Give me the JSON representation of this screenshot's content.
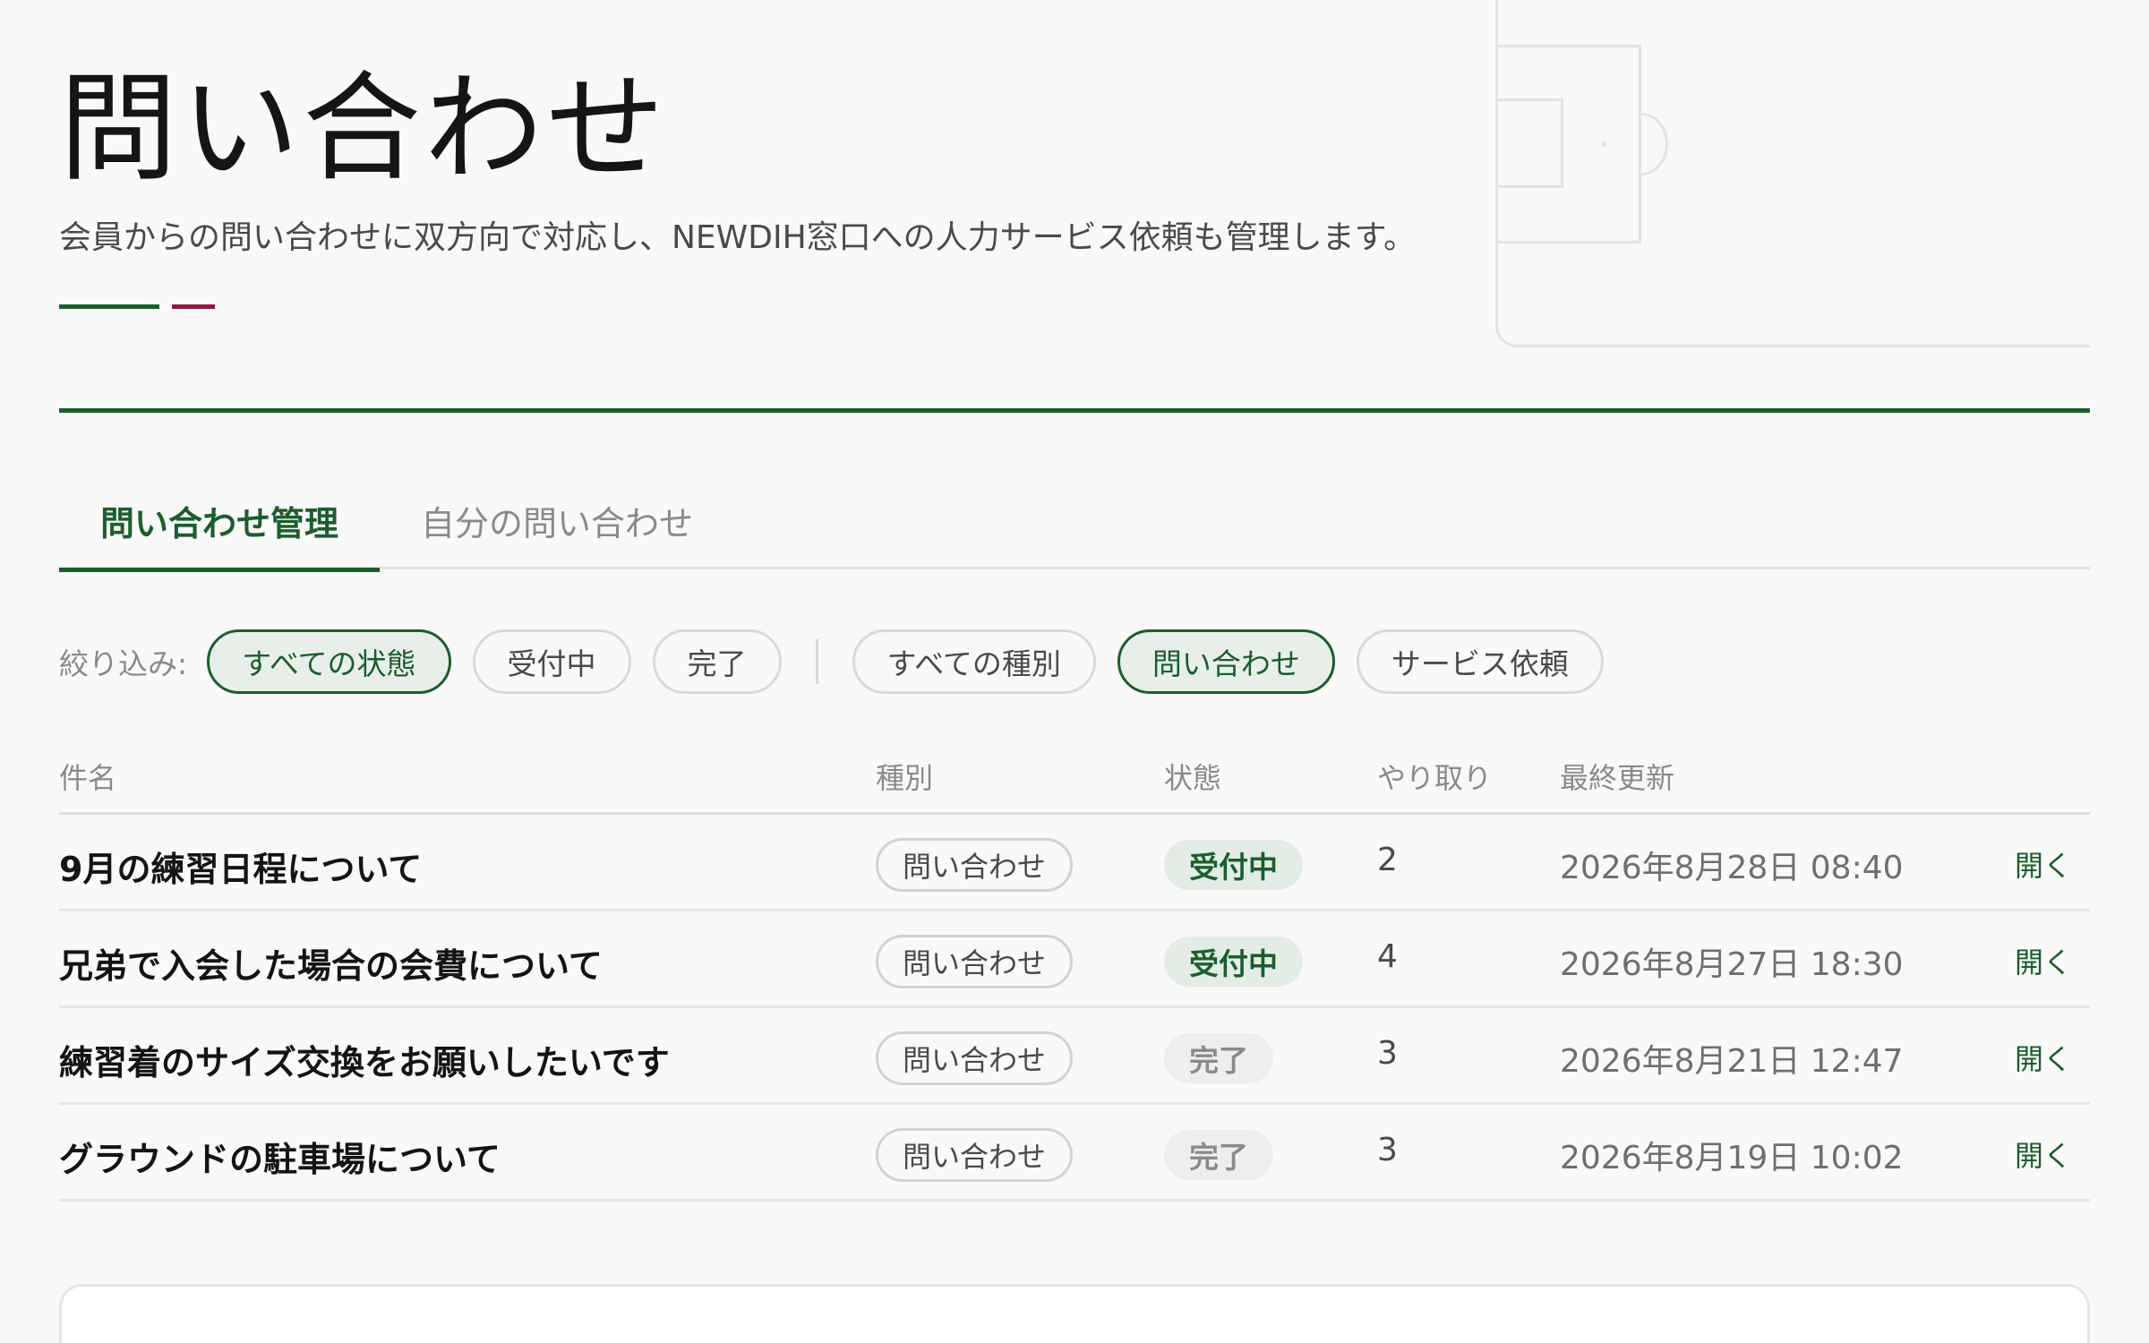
{
  "header": {
    "title": "問い合わせ",
    "subtitle": "会員からの問い合わせに双方向で対応し、NEWDIH窓口への人力サービス依頼も管理します。"
  },
  "tabs": [
    {
      "label": "問い合わせ管理",
      "active": true
    },
    {
      "label": "自分の問い合わせ",
      "active": false
    }
  ],
  "filters": {
    "label": "絞り込み:",
    "status": [
      {
        "label": "すべての状態",
        "active": true
      },
      {
        "label": "受付中",
        "active": false
      },
      {
        "label": "完了",
        "active": false
      }
    ],
    "type": [
      {
        "label": "すべての種別",
        "active": false
      },
      {
        "label": "問い合わせ",
        "active": true
      },
      {
        "label": "サービス依頼",
        "active": false
      }
    ]
  },
  "table": {
    "headers": {
      "name": "件名",
      "type": "種別",
      "status": "状態",
      "count": "やり取り",
      "updated": "最終更新"
    },
    "rows": [
      {
        "name": "9月の練習日程について",
        "type": "問い合わせ",
        "status": "受付中",
        "count": "2",
        "updated": "2026年8月28日 08:40",
        "action": "開く"
      },
      {
        "name": "兄弟で入会した場合の会費について",
        "type": "問い合わせ",
        "status": "受付中",
        "count": "4",
        "updated": "2026年8月27日 18:30",
        "action": "開く"
      },
      {
        "name": "練習着のサイズ交換をお願いしたいです",
        "type": "問い合わせ",
        "status": "完了",
        "count": "3",
        "updated": "2026年8月21日 12:47",
        "action": "開く"
      },
      {
        "name": "グラウンドの駐車場について",
        "type": "問い合わせ",
        "status": "完了",
        "count": "3",
        "updated": "2026年8月19日 10:02",
        "action": "開く"
      }
    ]
  },
  "colors": {
    "accent_green": "#1b5e2c",
    "accent_red": "#8e1c3c",
    "background": "#f9f9f9"
  }
}
